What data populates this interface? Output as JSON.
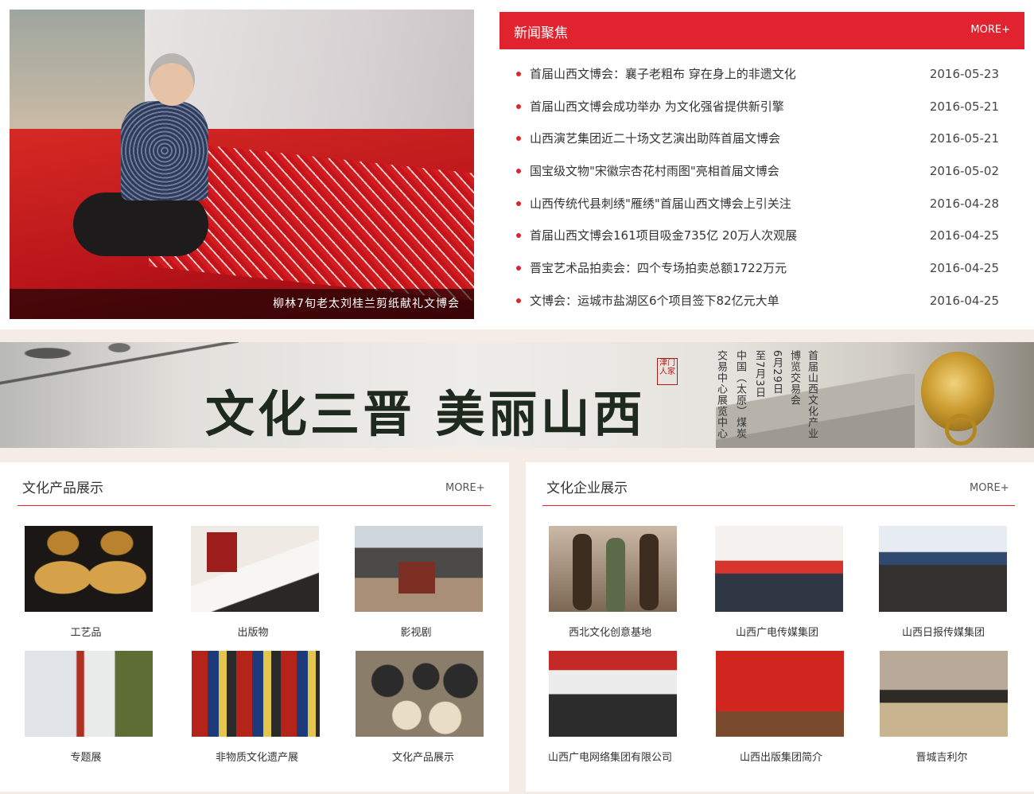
{
  "feature": {
    "caption": "柳林7旬老太刘桂兰剪纸献礼文博会"
  },
  "news": {
    "title": "新闻聚焦",
    "more": "MORE+",
    "items": [
      {
        "title": "首届山西文博会：襄子老粗布 穿在身上的非遗文化",
        "date": "2016-05-23"
      },
      {
        "title": "首届山西文博会成功举办 为文化强省提供新引擎",
        "date": "2016-05-21"
      },
      {
        "title": "山西演艺集团近二十场文艺演出助阵首届文博会",
        "date": "2016-05-21"
      },
      {
        "title": "国宝级文物\"宋徽宗杏花村雨图\"亮相首届文博会",
        "date": "2016-05-02"
      },
      {
        "title": "山西传统代县刺绣\"雁绣\"首届山西文博会上引关注",
        "date": "2016-04-28"
      },
      {
        "title": "首届山西文博会161项目吸金735亿 20万人次观展",
        "date": "2016-04-25"
      },
      {
        "title": "晋宝艺术品拍卖会：四个专场拍卖总额1722万元",
        "date": "2016-04-25"
      },
      {
        "title": "文博会：运城市盐湖区6个项目签下82亿元大单",
        "date": "2016-04-25"
      }
    ]
  },
  "banner": {
    "slogan": "文化三晋 美丽山西",
    "stamp": "津门人家",
    "col1": "首届山西文化产业",
    "col2": "博览交易会",
    "col3": "6月29日",
    "col4": "至7月3日",
    "col5": "中国（太原）煤炭",
    "col6": "交易中心展览中心"
  },
  "products": {
    "title": "文化产品展示",
    "more": "MORE+",
    "items": [
      {
        "label": "工艺品",
        "image": "gourd-carving"
      },
      {
        "label": "出版物",
        "image": "books"
      },
      {
        "label": "影视剧",
        "image": "courtyard"
      },
      {
        "label": "专题展",
        "image": "expo-booth"
      },
      {
        "label": "非物质文化遗产展",
        "image": "opera-figures"
      },
      {
        "label": "文化产品展示",
        "image": "plates"
      }
    ]
  },
  "enterprises": {
    "title": "文化企业展示",
    "more": "MORE+",
    "items": [
      {
        "label": "西北文化创意基地",
        "image": "statues"
      },
      {
        "label": "山西广电传媒集团",
        "image": "radio-booth"
      },
      {
        "label": "山西日报传媒集团",
        "image": "conference"
      },
      {
        "label": "山西广电网络集团有限公司",
        "image": "group-photo"
      },
      {
        "label": "山西出版集团简介",
        "image": "publishing-stage"
      },
      {
        "label": "晋城吉利尔",
        "image": "scroll-painting"
      }
    ]
  },
  "colors": {
    "accent": "#e0232e",
    "background": "#f6ece6"
  }
}
